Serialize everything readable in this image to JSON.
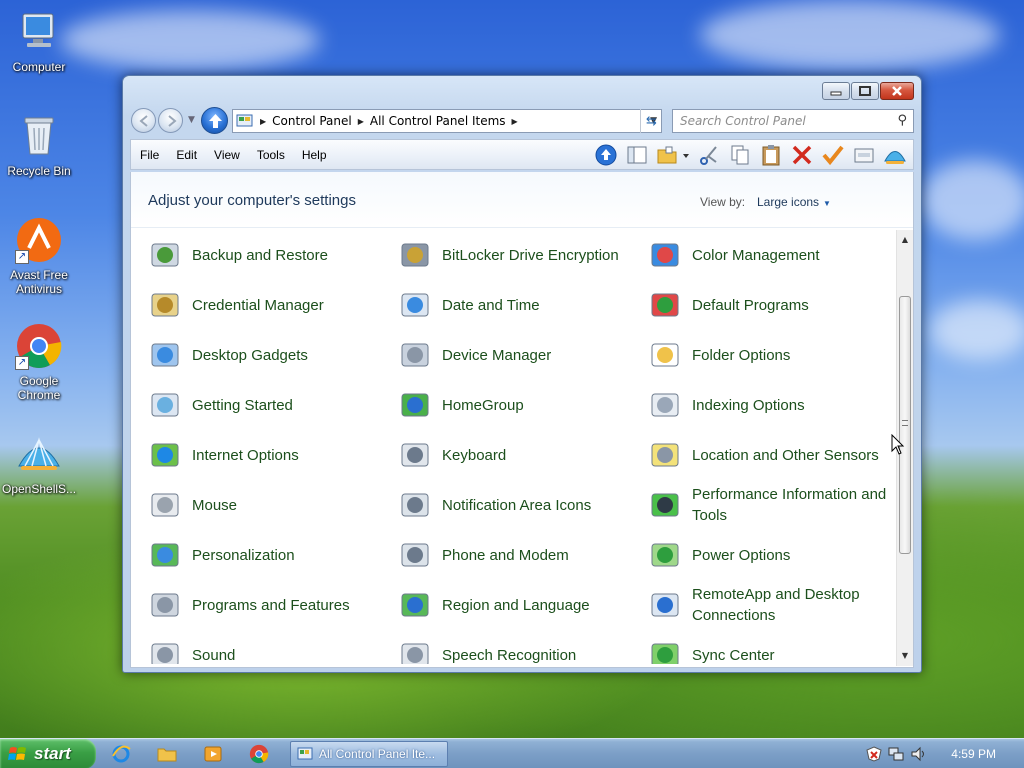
{
  "desktop": {
    "icons": [
      {
        "label": "Computer"
      },
      {
        "label": "Recycle Bin"
      },
      {
        "label": "Avast Free Antivirus"
      },
      {
        "label": "Google Chrome"
      },
      {
        "label": "OpenShellS..."
      }
    ]
  },
  "window": {
    "address": {
      "crumbs": [
        "Control Panel",
        "All Control Panel Items"
      ]
    },
    "search": {
      "placeholder": "Search Control Panel"
    },
    "menu": [
      "File",
      "Edit",
      "View",
      "Tools",
      "Help"
    ],
    "title": "Adjust your computer's settings",
    "view_by_label": "View by:",
    "view_by_value": "Large icons",
    "items": [
      {
        "label": "Backup and Restore",
        "icon": "backup-icon"
      },
      {
        "label": "BitLocker Drive Encryption",
        "icon": "bitlocker-icon"
      },
      {
        "label": "Color Management",
        "icon": "color-management-icon"
      },
      {
        "label": "Credential Manager",
        "icon": "credential-icon"
      },
      {
        "label": "Date and Time",
        "icon": "calendar-clock-icon"
      },
      {
        "label": "Default Programs",
        "icon": "default-programs-icon"
      },
      {
        "label": "Desktop Gadgets",
        "icon": "gadgets-icon"
      },
      {
        "label": "Device Manager",
        "icon": "device-manager-icon"
      },
      {
        "label": "Folder Options",
        "icon": "folder-options-icon"
      },
      {
        "label": "Getting Started",
        "icon": "getting-started-icon"
      },
      {
        "label": "HomeGroup",
        "icon": "homegroup-icon"
      },
      {
        "label": "Indexing Options",
        "icon": "indexing-icon"
      },
      {
        "label": "Internet Options",
        "icon": "internet-options-icon"
      },
      {
        "label": "Keyboard",
        "icon": "keyboard-icon"
      },
      {
        "label": "Location and Other Sensors",
        "icon": "sensors-icon"
      },
      {
        "label": "Mouse",
        "icon": "mouse-icon"
      },
      {
        "label": "Notification Area Icons",
        "icon": "notification-icon"
      },
      {
        "label": "Performance Information and Tools",
        "icon": "performance-icon"
      },
      {
        "label": "Personalization",
        "icon": "personalization-icon"
      },
      {
        "label": "Phone and Modem",
        "icon": "phone-icon"
      },
      {
        "label": "Power Options",
        "icon": "power-icon"
      },
      {
        "label": "Programs and Features",
        "icon": "programs-icon"
      },
      {
        "label": "Region and Language",
        "icon": "globe-icon"
      },
      {
        "label": "RemoteApp and Desktop Connections",
        "icon": "remoteapp-icon"
      },
      {
        "label": "Sound",
        "icon": "speaker-icon"
      },
      {
        "label": "Speech Recognition",
        "icon": "microphone-icon"
      },
      {
        "label": "Sync Center",
        "icon": "sync-icon"
      }
    ]
  },
  "taskbar": {
    "start_label": "start",
    "task_label": "All Control Panel Ite...",
    "clock": "4:59 PM"
  },
  "colors": {
    "accent": "#1e395b",
    "item_text": "#1c4f1c",
    "start_green": "#3a9f45"
  }
}
